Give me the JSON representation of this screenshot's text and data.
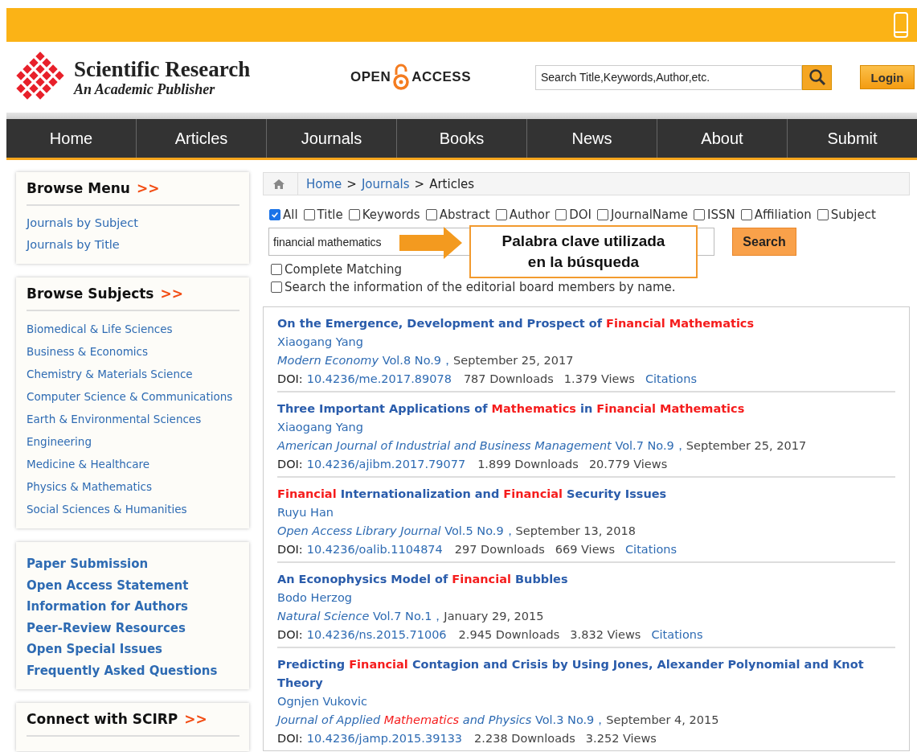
{
  "header": {
    "logo_title": "Scientific Research",
    "logo_subtitle": "An Academic Publisher",
    "open_access": [
      "OPEN",
      "ACCESS"
    ],
    "search": {
      "placeholder": "Search Title,Keywords,Author,etc."
    },
    "login_button": "Login"
  },
  "nav": [
    "Home",
    "Articles",
    "Journals",
    "Books",
    "News",
    "About",
    "Submit"
  ],
  "sidebar": {
    "browse_menu": {
      "title": "Browse Menu",
      "arrow": ">>",
      "items": [
        "Journals by Subject",
        "Journals by Title"
      ]
    },
    "browse_subjects": {
      "title": "Browse Subjects",
      "arrow": ">>",
      "items": [
        "Biomedical & Life Sciences",
        "Business & Economics",
        "Chemistry & Materials Science",
        "Computer Science & Communications",
        "Earth & Environmental Sciences",
        "Engineering",
        "Medicine & Healthcare",
        "Physics & Mathematics",
        "Social Sciences & Humanities"
      ]
    },
    "links": [
      "Paper Submission",
      "Open Access Statement",
      "Information for Authors",
      "Peer-Review Resources",
      "Open Special Issues",
      "Frequently Asked Questions"
    ],
    "connect": {
      "title": "Connect with SCIRP",
      "arrow": ">>"
    }
  },
  "breadcrumb": [
    {
      "text": "Home",
      "kind": "link"
    },
    {
      "text": ">",
      "kind": "separator"
    },
    {
      "text": "Journals",
      "kind": "link"
    },
    {
      "text": ">",
      "kind": "separator"
    },
    {
      "text": "Articles",
      "kind": "current"
    }
  ],
  "filters": [
    {
      "label": "All",
      "checked": true
    },
    {
      "label": "Title",
      "checked": false
    },
    {
      "label": "Keywords",
      "checked": false
    },
    {
      "label": "Abstract",
      "checked": false
    },
    {
      "label": "Author",
      "checked": false
    },
    {
      "label": "DOI",
      "checked": false
    },
    {
      "label": "JournalName",
      "checked": false
    },
    {
      "label": "ISSN",
      "checked": false
    },
    {
      "label": "Affiliation",
      "checked": false
    },
    {
      "label": "Subject",
      "checked": false
    }
  ],
  "search": {
    "value": "financial mathematics",
    "button": "Search",
    "options": [
      {
        "label": "Complete Matching",
        "checked": false
      },
      {
        "label": "Search the information of the editorial board members by name.",
        "checked": false
      }
    ]
  },
  "annotation": {
    "lines": [
      "Palabra clave utilizada",
      "en la búsqueda"
    ]
  },
  "results": [
    {
      "title": [
        {
          "text": "On the Emergence, Development and Prospect of ",
          "highlight": false
        },
        {
          "text": "Financial Mathematics",
          "highlight": true
        }
      ],
      "author": "Xiaogang Yang",
      "journal": [
        {
          "text": "Modern Economy",
          "highlight": false
        }
      ],
      "issue": "Vol.8 No.9，",
      "date": "September 25, 2017",
      "doi_label": "DOI:",
      "doi": "10.4236/me.2017.89078",
      "downloads": "787 Downloads",
      "views": "1.379 Views",
      "citations": "Citations"
    },
    {
      "title": [
        {
          "text": "Three Important Applications of ",
          "highlight": false
        },
        {
          "text": "Mathematics",
          "highlight": true
        },
        {
          "text": " in ",
          "highlight": false
        },
        {
          "text": "Financial Mathematics",
          "highlight": true
        }
      ],
      "author": "Xiaogang Yang",
      "journal": [
        {
          "text": "American Journal of Industrial and Business Management",
          "highlight": false
        }
      ],
      "issue": "Vol.7 No.9，",
      "date": "September 25, 2017",
      "doi_label": "DOI:",
      "doi": "10.4236/ajibm.2017.79077",
      "downloads": "1.899 Downloads",
      "views": "20.779 Views"
    },
    {
      "title": [
        {
          "text": "Financial",
          "highlight": true
        },
        {
          "text": " Internationalization and ",
          "highlight": false
        },
        {
          "text": "Financial",
          "highlight": true
        },
        {
          "text": " Security Issues",
          "highlight": false
        }
      ],
      "author": "Ruyu Han",
      "journal": [
        {
          "text": "Open Access Library Journal",
          "highlight": false
        }
      ],
      "issue": "Vol.5 No.9，",
      "date": "September 13, 2018",
      "doi_label": "DOI:",
      "doi": "10.4236/oalib.1104874",
      "downloads": "297 Downloads",
      "views": "669 Views",
      "citations": "Citations"
    },
    {
      "title": [
        {
          "text": "An Econophysics Model of ",
          "highlight": false
        },
        {
          "text": "Financial",
          "highlight": true
        },
        {
          "text": " Bubbles",
          "highlight": false
        }
      ],
      "author": "Bodo Herzog",
      "journal": [
        {
          "text": "Natural Science",
          "highlight": false
        }
      ],
      "issue": "Vol.7 No.1，",
      "date": "January 29, 2015",
      "doi_label": "DOI:",
      "doi": "10.4236/ns.2015.71006",
      "downloads": "2.945 Downloads",
      "views": "3.832 Views",
      "citations": "Citations"
    },
    {
      "title": [
        {
          "text": "Predicting ",
          "highlight": false
        },
        {
          "text": "Financial",
          "highlight": true
        },
        {
          "text": " Contagion and Crisis by Using Jones, Alexander Polynomial and Knot Theory",
          "highlight": false
        }
      ],
      "author": "Ognjen Vukovic",
      "journal": [
        {
          "text": "Journal of Applied ",
          "highlight": false
        },
        {
          "text": "Mathematics",
          "highlight": true
        },
        {
          "text": " and Physics",
          "highlight": false
        }
      ],
      "issue": "Vol.3 No.9，",
      "date": "September 4, 2015",
      "doi_label": "DOI:",
      "doi": "10.4236/jamp.2015.39133",
      "downloads": "2.238 Downloads",
      "views": "3.252 Views"
    }
  ]
}
